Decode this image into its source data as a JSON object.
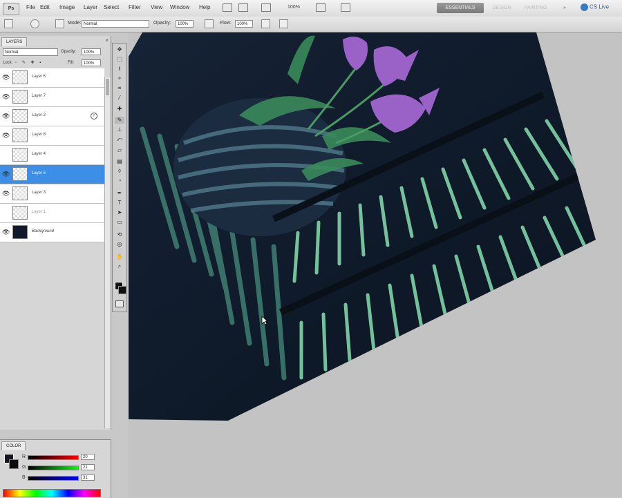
{
  "menu": {
    "logo": "Ps",
    "items": [
      "File",
      "Edit",
      "Image",
      "Layer",
      "Select",
      "Filter",
      "View",
      "Window",
      "Help"
    ],
    "zoom": "100%",
    "workspaces": [
      "ESSENTIALS",
      "DESIGN",
      "PAINTING"
    ],
    "more": "»",
    "cs_live": "CS Live"
  },
  "options": {
    "mode_label": "Mode:",
    "mode_value": "Normal",
    "opacity_label": "Opacity:",
    "opacity_value": "100%",
    "flow_label": "Flow:",
    "flow_value": "100%"
  },
  "layers_panel": {
    "tab": "LAYERS",
    "close": "×",
    "blend_mode": "Normal",
    "opacity_label": "Opacity:",
    "opacity_value": "100%",
    "lock_label": "Lock:",
    "fill_label": "Fill:",
    "fill_value": "100%",
    "layers": [
      {
        "name": "Layer 6",
        "visible": true
      },
      {
        "name": "Layer 7",
        "visible": true
      },
      {
        "name": "Layer 2",
        "visible": true,
        "fx": true
      },
      {
        "name": "Layer 8",
        "visible": true
      },
      {
        "name": "Layer 4",
        "visible": false
      },
      {
        "name": "Layer 5",
        "visible": true,
        "selected": true
      },
      {
        "name": "Layer 3",
        "visible": true
      },
      {
        "name": "Layer 1",
        "visible": false
      },
      {
        "name": "Background",
        "visible": true
      }
    ]
  },
  "color_panel": {
    "tab": "COLOR",
    "rows": [
      {
        "label": "R",
        "value": "20"
      },
      {
        "label": "G",
        "value": "21"
      },
      {
        "label": "B",
        "value": "31"
      }
    ]
  },
  "colors": {
    "selection": "#3d8ee6",
    "canvas_bg": "#c3c3c3",
    "artwork_dark": "#101a2a",
    "petal": "#9a62c6",
    "leaf": "#3a8a5a",
    "stripe": "#6fc8a0"
  }
}
